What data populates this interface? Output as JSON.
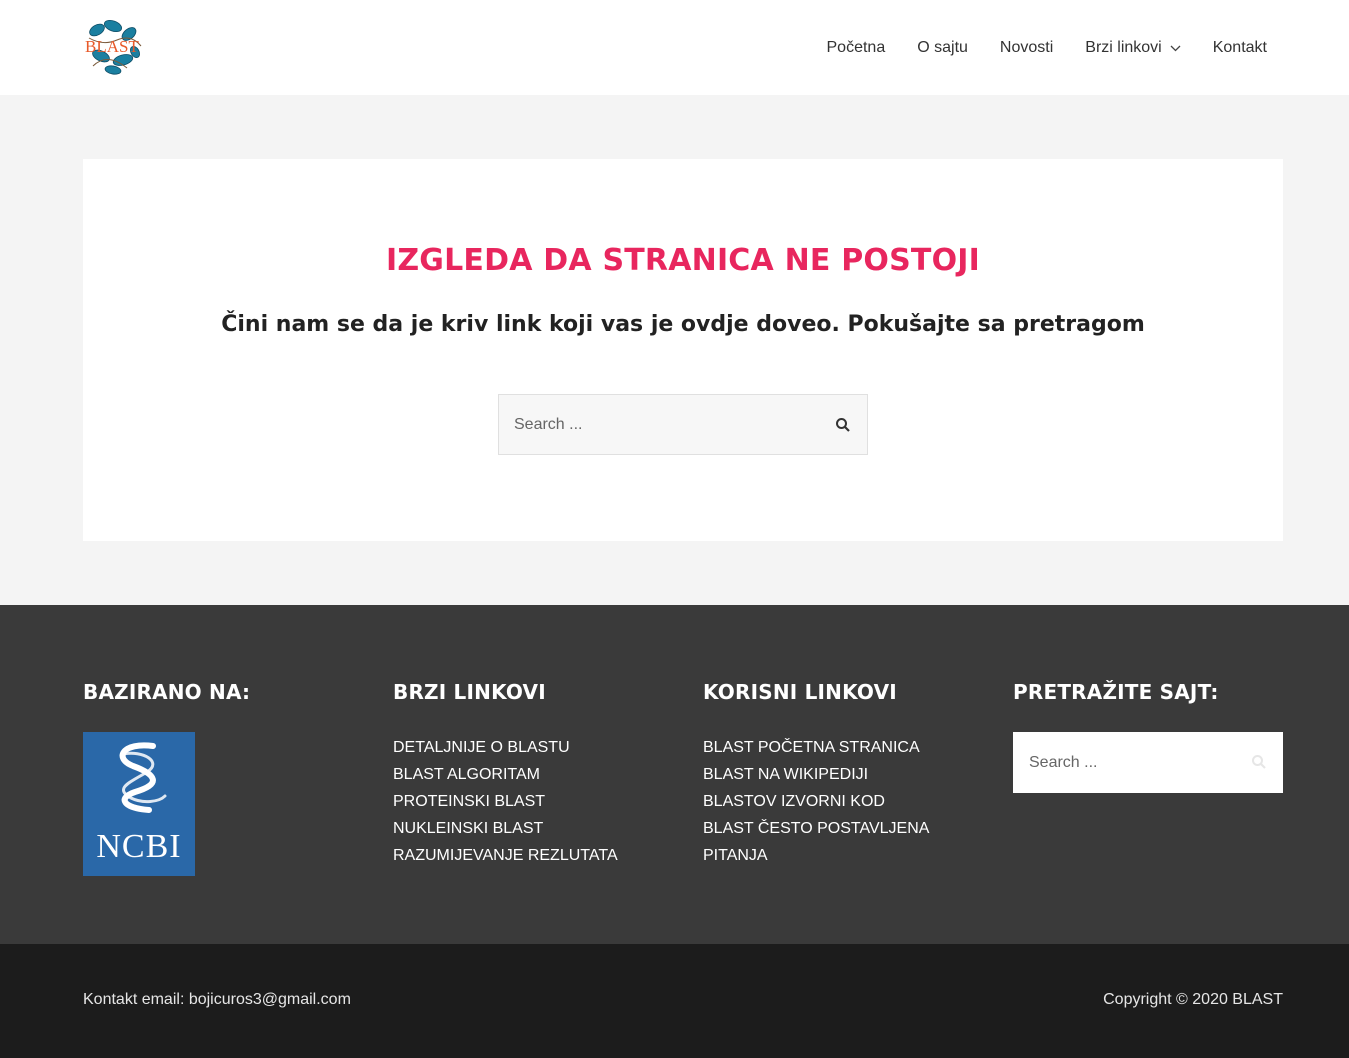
{
  "header": {
    "logo_text": "BLAST",
    "nav": [
      {
        "label": "Početna"
      },
      {
        "label": "O sajtu"
      },
      {
        "label": "Novosti"
      },
      {
        "label": "Brzi linkovi",
        "has_dropdown": true
      },
      {
        "label": "Kontakt"
      }
    ]
  },
  "main": {
    "title": "IZGLEDA DA STRANICA NE POSTOJI",
    "subtitle": "Čini nam se da je kriv link koji vas je ovdje doveo. Pokušajte sa pretragom",
    "search": {
      "placeholder": "Search ..."
    }
  },
  "footer": {
    "col1": {
      "title": "BAZIRANO NA:",
      "image_text": "NCBI"
    },
    "col2": {
      "title": "BRZI LINKOVI",
      "links": [
        "DETALJNIJE O BLASTU",
        "BLAST ALGORITAM",
        "PROTEINSKI BLAST",
        "NUKLEINSKI BLAST",
        "RAZUMIJEVANJE REZLUTATA"
      ]
    },
    "col3": {
      "title": "KORISNI LINKOVI",
      "links": [
        "BLAST POČETNA STRANICA",
        "BLAST NA WIKIPEDIJI",
        "BLASTOV IZVORNI KOD",
        "BLAST ČESTO POSTAVLJENA",
        "PITANJA"
      ]
    },
    "col4": {
      "title": "PRETRAŽITE SAJT:",
      "search_placeholder": "Search ..."
    }
  },
  "bottom": {
    "contact": "Kontakt email: bojicuros3@gmail.com",
    "copyright": "Copyright © 2020 BLAST"
  },
  "colors": {
    "accent": "#e8265e",
    "footer_bg": "#3a3a3a",
    "bottom_bg": "#1c1c1c",
    "ncbi_blue": "#2a68a8"
  }
}
